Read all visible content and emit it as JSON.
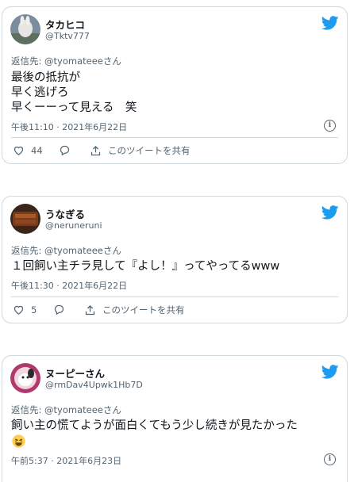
{
  "tweets": [
    {
      "name": "タカヒコ",
      "handle": "@Tktv777",
      "reply_label": "返信先: @tyomateeeさん",
      "body": "最後の抵抗が\n早く逃げろ\n早くーーって見える　笑",
      "timestamp": "午後11:10 · 2021年6月22日",
      "likes": "44",
      "share_label": "このツイートを共有"
    },
    {
      "name": "うなぎる",
      "handle": "@neruneruni",
      "reply_label": "返信先: @tyomateeeさん",
      "body": "１回飼い主チラ見して『よし！』ってやってるwww",
      "timestamp": "午後11:30 · 2021年6月22日",
      "likes": "5",
      "share_label": "このツイートを共有"
    },
    {
      "name": "ヌーピーさん",
      "handle": "@rmDav4Upwk1Hb7D",
      "reply_label": "返信先: @tyomateeeさん",
      "body": "飼い主の慌てようが面白くてもう少し続きが見たかった",
      "timestamp": "午前5:37 · 2021年6月23日"
    }
  ],
  "colors": {
    "brand": "#1d9bf0",
    "muted": "#536471",
    "border": "#cfd9de"
  },
  "icons": {
    "bird": "twitter-bird-icon",
    "info": "info-icon",
    "like": "heart-icon",
    "reply": "reply-icon",
    "share": "share-icon",
    "emoji": "grinning-squinting-face-emoji"
  }
}
